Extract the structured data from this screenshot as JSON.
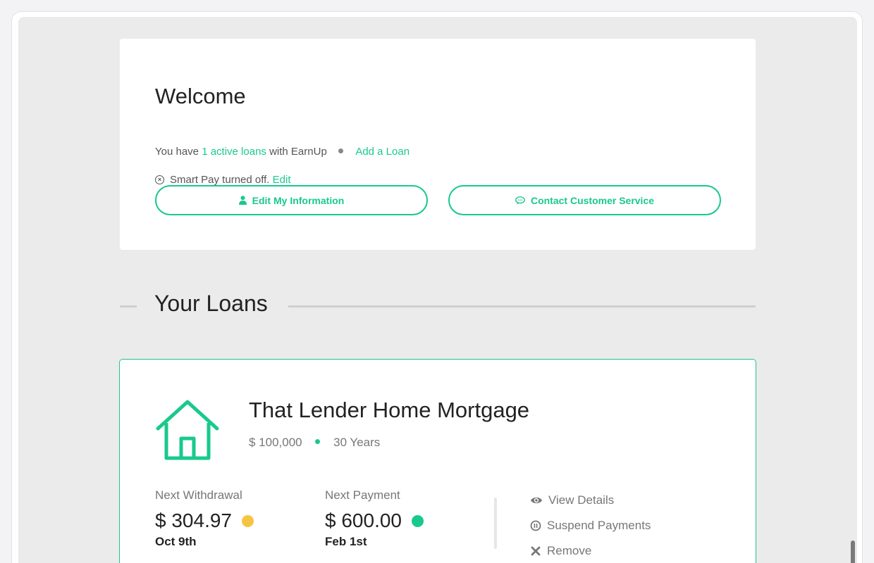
{
  "colors": {
    "accent": "#19c98b",
    "warning": "#f5c542",
    "background": "#ebebeb"
  },
  "welcome": {
    "title": "Welcome",
    "loans_prefix": "You have ",
    "loans_link": "1 active loans",
    "loans_suffix": " with EarnUp",
    "add_loan": "Add a Loan",
    "smartpay_text": "Smart Pay turned off.",
    "smartpay_edit": "Edit",
    "edit_info_button": "Edit My Information",
    "contact_button": "Contact Customer Service"
  },
  "loans_section": {
    "title": "Your Loans"
  },
  "loan": {
    "name": "That Lender Home Mortgage",
    "amount": "$ 100,000",
    "term": "30 Years",
    "next_withdrawal": {
      "label": "Next Withdrawal",
      "amount": "$ 304.97",
      "date": "Oct 9th",
      "status_color": "#f5c542"
    },
    "next_payment": {
      "label": "Next Payment",
      "amount": "$ 600.00",
      "date": "Feb 1st",
      "status_color": "#19c98b"
    },
    "actions": {
      "view": "View Details",
      "suspend": "Suspend Payments",
      "remove": "Remove"
    }
  }
}
